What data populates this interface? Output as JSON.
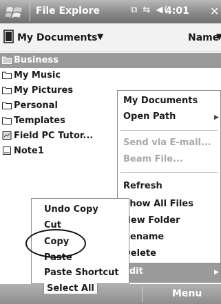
{
  "titlebar": {
    "title": "File Explore",
    "status_icons": "⧉ ⇆ ◀(",
    "time": "4:01",
    "close": "✕"
  },
  "pathbar": {
    "folder": "My Documents",
    "folder_caret": "▼",
    "sort": "Name",
    "sort_caret": "▼"
  },
  "files": [
    {
      "name": "Business",
      "icon": "folder-icon",
      "selected": true
    },
    {
      "name": "My Music",
      "icon": "folder-icon"
    },
    {
      "name": "My Pictures",
      "icon": "folder-icon"
    },
    {
      "name": "Personal",
      "icon": "folder-icon"
    },
    {
      "name": "Templates",
      "icon": "folder-icon"
    },
    {
      "name": "Field PC Tutor...",
      "icon": "document-shortcut-icon"
    },
    {
      "name": "Note1",
      "icon": "note-icon"
    }
  ],
  "context_menu": {
    "my_documents": "My Documents",
    "open_path": "Open Path",
    "send_email": "Send via E-mail...",
    "beam_file": "Beam File...",
    "refresh": "Refresh",
    "show_all_files": "Show All Files",
    "new_folder": "New Folder",
    "rename": "Rename",
    "delete": "Delete",
    "edit": "Edit",
    "submenu_arrow": "▶"
  },
  "edit_menu": {
    "undo_copy": "Undo Copy",
    "cut": "Cut",
    "copy": "Copy",
    "paste": "Paste",
    "paste_shortcut": "Paste Shortcut",
    "select_all": "Select All"
  },
  "softkeys": {
    "menu": "Menu"
  },
  "colors": {
    "selection": "#9a9a9a",
    "titlebar": "#8a8a8a"
  }
}
